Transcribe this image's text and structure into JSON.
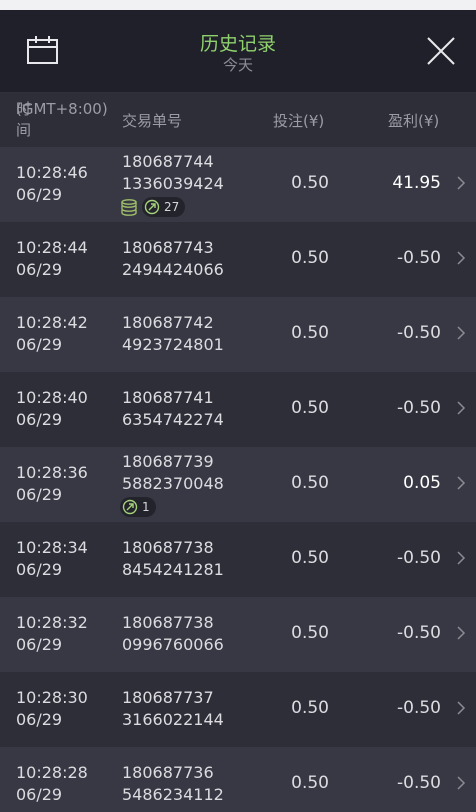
{
  "header": {
    "title": "历史记录",
    "subtitle": "今天",
    "calendar_icon": "calendar-icon",
    "close_icon": "close-icon"
  },
  "columns": {
    "time_line1": "时间",
    "time_line2": "(GMT+8:00)",
    "order": "交易单号",
    "bet": "投注(¥)",
    "profit": "盈利(¥)"
  },
  "rows": [
    {
      "time": "10:28:46",
      "date": "06/29",
      "order1": "180687744",
      "order2": "1336039424",
      "bet": "0.50",
      "profit": "41.95",
      "win": true,
      "coins": true,
      "spins": "27"
    },
    {
      "time": "10:28:44",
      "date": "06/29",
      "order1": "180687743",
      "order2": "2494424066",
      "bet": "0.50",
      "profit": "-0.50",
      "win": false
    },
    {
      "time": "10:28:42",
      "date": "06/29",
      "order1": "180687742",
      "order2": "4923724801",
      "bet": "0.50",
      "profit": "-0.50",
      "win": false
    },
    {
      "time": "10:28:40",
      "date": "06/29",
      "order1": "180687741",
      "order2": "6354742274",
      "bet": "0.50",
      "profit": "-0.50",
      "win": false
    },
    {
      "time": "10:28:36",
      "date": "06/29",
      "order1": "180687739",
      "order2": "5882370048",
      "bet": "0.50",
      "profit": "0.05",
      "win": true,
      "coins": false,
      "spins": "1"
    },
    {
      "time": "10:28:34",
      "date": "06/29",
      "order1": "180687738",
      "order2": "8454241281",
      "bet": "0.50",
      "profit": "-0.50",
      "win": false
    },
    {
      "time": "10:28:32",
      "date": "06/29",
      "order1": "180687738",
      "order2": "0996760066",
      "bet": "0.50",
      "profit": "-0.50",
      "win": false
    },
    {
      "time": "10:28:30",
      "date": "06/29",
      "order1": "180687737",
      "order2": "3166022144",
      "bet": "0.50",
      "profit": "-0.50",
      "win": false
    },
    {
      "time": "10:28:28",
      "date": "06/29",
      "order1": "180687736",
      "order2": "5486234112",
      "bet": "0.50",
      "profit": "-0.50",
      "win": false
    }
  ],
  "colors": {
    "accent": "#8fd16d",
    "background": "#2b2c36",
    "row_alt": "#373844"
  }
}
